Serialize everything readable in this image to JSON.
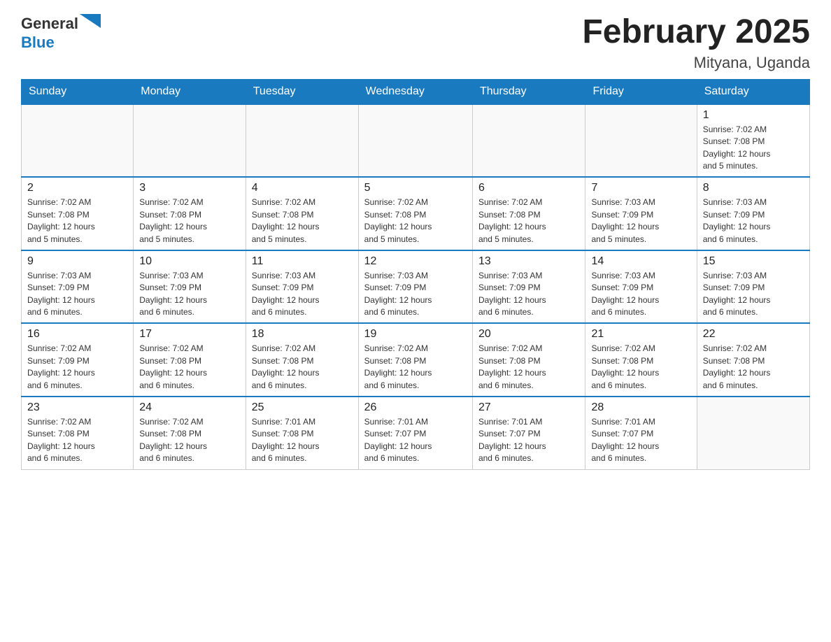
{
  "header": {
    "logo": {
      "text_general": "General",
      "text_blue": "Blue",
      "flag_shape": "triangle"
    },
    "title": "February 2025",
    "location": "Mityana, Uganda"
  },
  "days_of_week": [
    "Sunday",
    "Monday",
    "Tuesday",
    "Wednesday",
    "Thursday",
    "Friday",
    "Saturday"
  ],
  "weeks": [
    [
      {
        "day": "",
        "info": ""
      },
      {
        "day": "",
        "info": ""
      },
      {
        "day": "",
        "info": ""
      },
      {
        "day": "",
        "info": ""
      },
      {
        "day": "",
        "info": ""
      },
      {
        "day": "",
        "info": ""
      },
      {
        "day": "1",
        "info": "Sunrise: 7:02 AM\nSunset: 7:08 PM\nDaylight: 12 hours\nand 5 minutes."
      }
    ],
    [
      {
        "day": "2",
        "info": "Sunrise: 7:02 AM\nSunset: 7:08 PM\nDaylight: 12 hours\nand 5 minutes."
      },
      {
        "day": "3",
        "info": "Sunrise: 7:02 AM\nSunset: 7:08 PM\nDaylight: 12 hours\nand 5 minutes."
      },
      {
        "day": "4",
        "info": "Sunrise: 7:02 AM\nSunset: 7:08 PM\nDaylight: 12 hours\nand 5 minutes."
      },
      {
        "day": "5",
        "info": "Sunrise: 7:02 AM\nSunset: 7:08 PM\nDaylight: 12 hours\nand 5 minutes."
      },
      {
        "day": "6",
        "info": "Sunrise: 7:02 AM\nSunset: 7:08 PM\nDaylight: 12 hours\nand 5 minutes."
      },
      {
        "day": "7",
        "info": "Sunrise: 7:03 AM\nSunset: 7:09 PM\nDaylight: 12 hours\nand 5 minutes."
      },
      {
        "day": "8",
        "info": "Sunrise: 7:03 AM\nSunset: 7:09 PM\nDaylight: 12 hours\nand 6 minutes."
      }
    ],
    [
      {
        "day": "9",
        "info": "Sunrise: 7:03 AM\nSunset: 7:09 PM\nDaylight: 12 hours\nand 6 minutes."
      },
      {
        "day": "10",
        "info": "Sunrise: 7:03 AM\nSunset: 7:09 PM\nDaylight: 12 hours\nand 6 minutes."
      },
      {
        "day": "11",
        "info": "Sunrise: 7:03 AM\nSunset: 7:09 PM\nDaylight: 12 hours\nand 6 minutes."
      },
      {
        "day": "12",
        "info": "Sunrise: 7:03 AM\nSunset: 7:09 PM\nDaylight: 12 hours\nand 6 minutes."
      },
      {
        "day": "13",
        "info": "Sunrise: 7:03 AM\nSunset: 7:09 PM\nDaylight: 12 hours\nand 6 minutes."
      },
      {
        "day": "14",
        "info": "Sunrise: 7:03 AM\nSunset: 7:09 PM\nDaylight: 12 hours\nand 6 minutes."
      },
      {
        "day": "15",
        "info": "Sunrise: 7:03 AM\nSunset: 7:09 PM\nDaylight: 12 hours\nand 6 minutes."
      }
    ],
    [
      {
        "day": "16",
        "info": "Sunrise: 7:02 AM\nSunset: 7:09 PM\nDaylight: 12 hours\nand 6 minutes."
      },
      {
        "day": "17",
        "info": "Sunrise: 7:02 AM\nSunset: 7:08 PM\nDaylight: 12 hours\nand 6 minutes."
      },
      {
        "day": "18",
        "info": "Sunrise: 7:02 AM\nSunset: 7:08 PM\nDaylight: 12 hours\nand 6 minutes."
      },
      {
        "day": "19",
        "info": "Sunrise: 7:02 AM\nSunset: 7:08 PM\nDaylight: 12 hours\nand 6 minutes."
      },
      {
        "day": "20",
        "info": "Sunrise: 7:02 AM\nSunset: 7:08 PM\nDaylight: 12 hours\nand 6 minutes."
      },
      {
        "day": "21",
        "info": "Sunrise: 7:02 AM\nSunset: 7:08 PM\nDaylight: 12 hours\nand 6 minutes."
      },
      {
        "day": "22",
        "info": "Sunrise: 7:02 AM\nSunset: 7:08 PM\nDaylight: 12 hours\nand 6 minutes."
      }
    ],
    [
      {
        "day": "23",
        "info": "Sunrise: 7:02 AM\nSunset: 7:08 PM\nDaylight: 12 hours\nand 6 minutes."
      },
      {
        "day": "24",
        "info": "Sunrise: 7:02 AM\nSunset: 7:08 PM\nDaylight: 12 hours\nand 6 minutes."
      },
      {
        "day": "25",
        "info": "Sunrise: 7:01 AM\nSunset: 7:08 PM\nDaylight: 12 hours\nand 6 minutes."
      },
      {
        "day": "26",
        "info": "Sunrise: 7:01 AM\nSunset: 7:07 PM\nDaylight: 12 hours\nand 6 minutes."
      },
      {
        "day": "27",
        "info": "Sunrise: 7:01 AM\nSunset: 7:07 PM\nDaylight: 12 hours\nand 6 minutes."
      },
      {
        "day": "28",
        "info": "Sunrise: 7:01 AM\nSunset: 7:07 PM\nDaylight: 12 hours\nand 6 minutes."
      },
      {
        "day": "",
        "info": ""
      }
    ]
  ]
}
